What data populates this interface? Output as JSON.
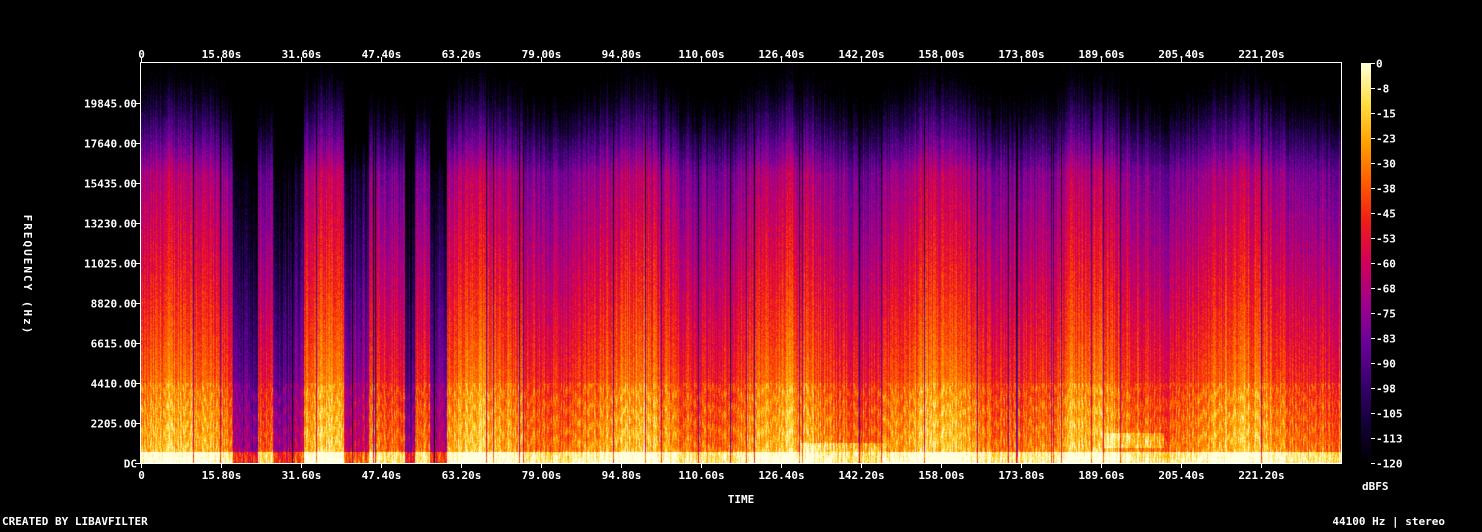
{
  "chart_data": {
    "type": "heatmap",
    "xlabel": "TIME",
    "ylabel": "FREQUENCY (Hz)",
    "x_unit": "s",
    "xlim": [
      0,
      236.99
    ],
    "ylim": [
      0,
      22050
    ],
    "x_ticks": [
      0,
      15.8,
      31.6,
      47.4,
      63.2,
      79.0,
      94.8,
      110.6,
      126.4,
      142.2,
      158.0,
      173.8,
      189.6,
      205.4,
      221.2
    ],
    "x_tick_labels": [
      "0",
      "15.80s",
      "31.60s",
      "47.40s",
      "63.20s",
      "79.00s",
      "94.80s",
      "110.60s",
      "126.40s",
      "142.20s",
      "158.00s",
      "173.80s",
      "189.60s",
      "205.40s",
      "221.20s"
    ],
    "y_ticks": [
      0,
      2205,
      4410,
      6615,
      8820,
      11025,
      13230,
      15435,
      17640,
      19845
    ],
    "y_tick_labels": [
      "DC",
      "2205.00",
      "4410.00",
      "6615.00",
      "8820.00",
      "11025.00",
      "13230.00",
      "15435.00",
      "17640.00",
      "19845.00"
    ],
    "colorbar": {
      "unit_label": "dBFS",
      "range": [
        -120,
        0
      ],
      "tick_labels": [
        "0",
        "-8",
        "-15",
        "-23",
        "-30",
        "-38",
        "-45",
        "-53",
        "-60",
        "-68",
        "-75",
        "-83",
        "-90",
        "-98",
        "-105",
        "-113",
        "-120"
      ],
      "colors": [
        "#000000",
        "#14003a",
        "#3a0070",
        "#6a009a",
        "#a0008a",
        "#d0005a",
        "#f01a1a",
        "#ff5a00",
        "#ffa000",
        "#ffe040",
        "#ffffe0"
      ]
    },
    "quiet_passages_s": [
      [
        18,
        23
      ],
      [
        26,
        32
      ],
      [
        40,
        45
      ],
      [
        52,
        54
      ],
      [
        57,
        60
      ]
    ],
    "bright_bands": [
      {
        "x": [
          130,
          147
        ],
        "y": [
          600,
          1100
        ]
      },
      {
        "x": [
          190,
          202
        ],
        "y": [
          800,
          1600
        ]
      }
    ]
  },
  "footer": {
    "credit": "CREATED BY LIBAVFILTER",
    "info": "44100 Hz | stereo"
  }
}
